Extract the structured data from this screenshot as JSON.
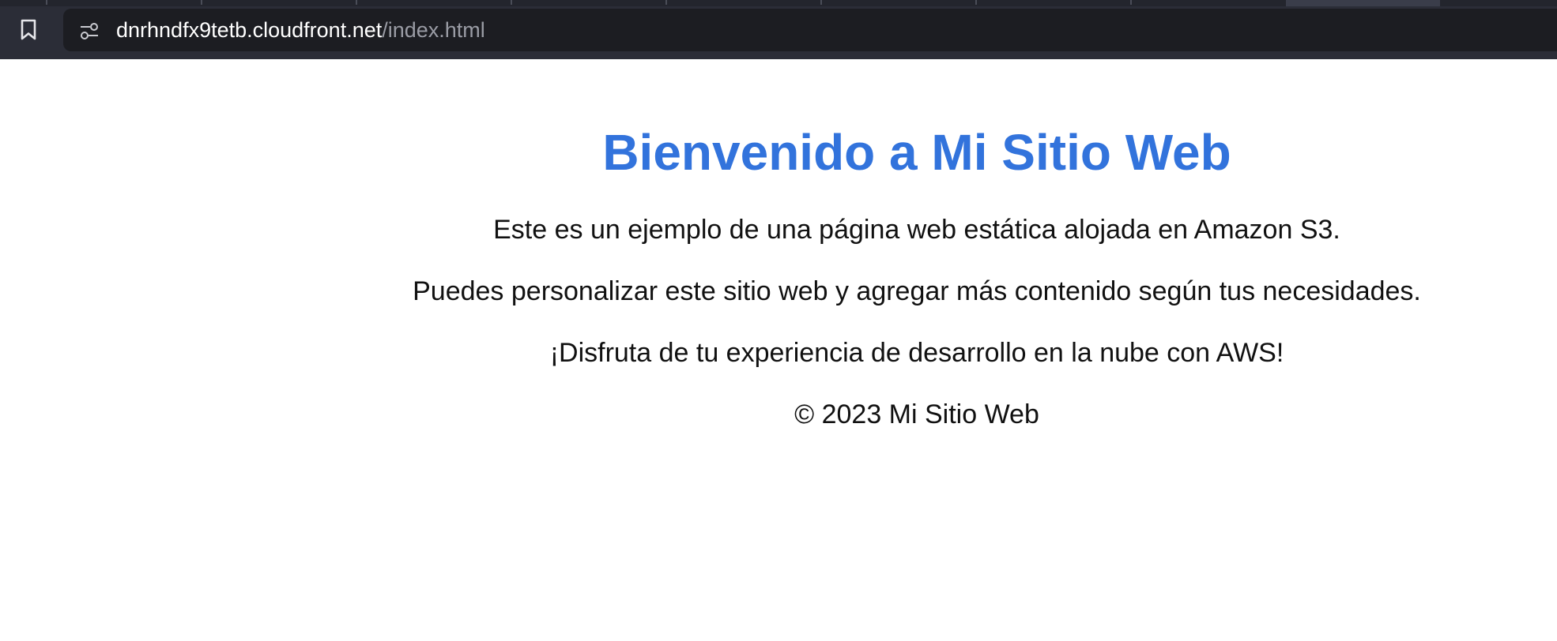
{
  "browser": {
    "url_host": "dnrhndfx9tetb.cloudfront.net",
    "url_path": "/index.html",
    "icons": {
      "bookmark": "bookmark-icon",
      "site_settings": "site-settings-icon"
    }
  },
  "page": {
    "heading": "Bienvenido a Mi Sitio Web",
    "paragraphs": [
      "Este es un ejemplo de una página web estática alojada en Amazon S3.",
      "Puedes personalizar este sitio web y agregar más contenido según tus necesidades.",
      "¡Disfruta de tu experiencia de desarrollo en la nube con AWS!"
    ],
    "footer": "© 2023 Mi Sitio Web"
  },
  "colors": {
    "heading": "#3273dc",
    "chrome": "#2b2d37",
    "address_bar": "#1c1d22"
  }
}
